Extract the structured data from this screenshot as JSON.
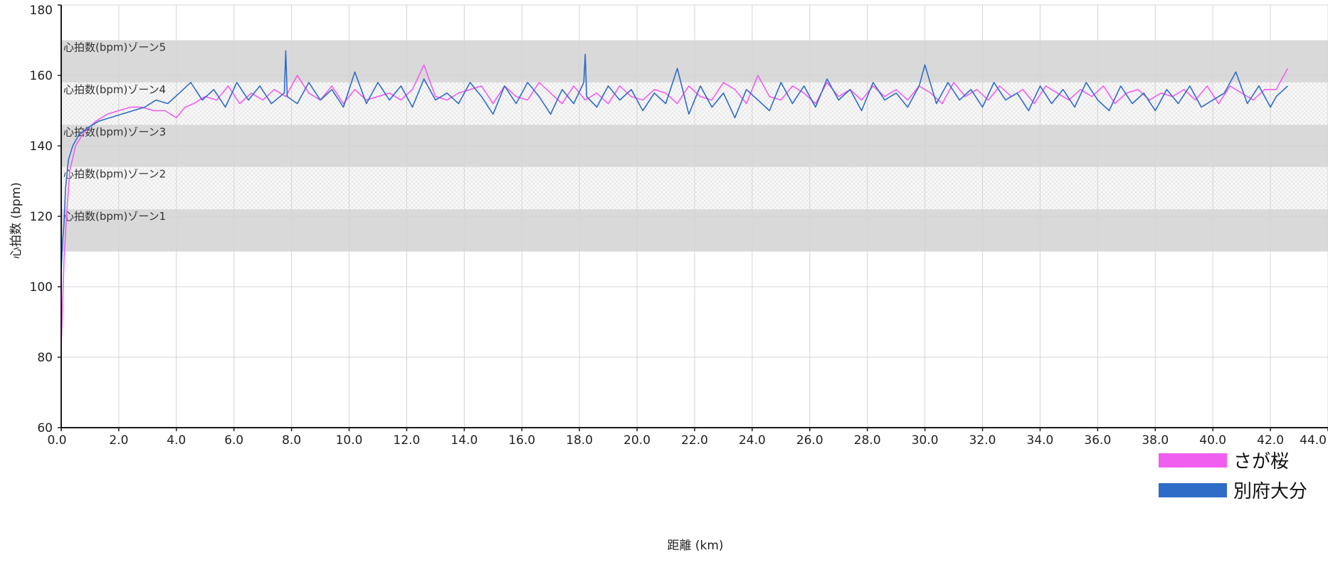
{
  "colors": {
    "series_sagazakura": "#f05ef0",
    "series_beppu_oita": "#2f6cc8",
    "zone_shade": "#d9d9d9",
    "zone_hatch": "#f1f1f1",
    "grid": "#d4d4d4",
    "axis": "#1a1a1a"
  },
  "chart_data": {
    "type": "line",
    "xlabel": "距離 (km)",
    "ylabel": "心拍数 (bpm)",
    "xlim": [
      0,
      44
    ],
    "ylim": [
      60,
      180
    ],
    "x_ticks": [
      "0.0",
      "2.0",
      "4.0",
      "6.0",
      "8.0",
      "10.0",
      "12.0",
      "14.0",
      "16.0",
      "18.0",
      "20.0",
      "22.0",
      "24.0",
      "26.0",
      "28.0",
      "30.0",
      "32.0",
      "34.0",
      "36.0",
      "38.0",
      "40.0",
      "42.0",
      "44.0"
    ],
    "y_ticks": [
      "60",
      "80",
      "100",
      "120",
      "140",
      "160",
      "180"
    ],
    "grid": true,
    "legend_position": "bottom-right",
    "zones": [
      {
        "label": "心拍数(bpm)ゾーン5",
        "from": 158,
        "to": 170,
        "style": "shaded"
      },
      {
        "label": "心拍数(bpm)ゾーン4",
        "from": 146,
        "to": 158,
        "style": "hatched"
      },
      {
        "label": "心拍数(bpm)ゾーン3",
        "from": 134,
        "to": 146,
        "style": "shaded"
      },
      {
        "label": "心拍数(bpm)ゾーン2",
        "from": 122,
        "to": 134,
        "style": "hatched"
      },
      {
        "label": "心拍数(bpm)ゾーン1",
        "from": 110,
        "to": 122,
        "style": "shaded"
      }
    ],
    "series": [
      {
        "name": "さが桜",
        "color": "#f05ef0",
        "x": [
          0.0,
          0.05,
          0.1,
          0.2,
          0.3,
          0.5,
          0.8,
          1.2,
          1.6,
          2.0,
          2.4,
          2.8,
          3.2,
          3.6,
          4.0,
          4.3,
          4.6,
          5.0,
          5.4,
          5.8,
          6.2,
          6.6,
          7.0,
          7.4,
          7.8,
          8.2,
          8.6,
          9.0,
          9.4,
          9.8,
          10.2,
          10.6,
          11.0,
          11.4,
          11.8,
          12.2,
          12.6,
          13.0,
          13.4,
          13.8,
          14.2,
          14.6,
          15.0,
          15.4,
          15.8,
          16.2,
          16.6,
          17.0,
          17.4,
          17.8,
          18.2,
          18.6,
          19.0,
          19.4,
          19.8,
          20.2,
          20.6,
          21.0,
          21.4,
          21.8,
          22.2,
          22.6,
          23.0,
          23.4,
          23.8,
          24.2,
          24.6,
          25.0,
          25.4,
          25.8,
          26.2,
          26.6,
          27.0,
          27.4,
          27.8,
          28.2,
          28.6,
          29.0,
          29.4,
          29.8,
          30.2,
          30.6,
          31.0,
          31.4,
          31.8,
          32.2,
          32.6,
          33.0,
          33.4,
          33.8,
          34.2,
          34.6,
          35.0,
          35.4,
          35.8,
          36.2,
          36.6,
          37.0,
          37.4,
          37.8,
          38.2,
          38.6,
          39.0,
          39.4,
          39.8,
          40.2,
          40.6,
          41.0,
          41.4,
          41.8,
          42.2,
          42.6
        ],
        "y": [
          83,
          95,
          108,
          122,
          133,
          140,
          144,
          147,
          149,
          150,
          151,
          151,
          150,
          150,
          148,
          151,
          152,
          154,
          153,
          157,
          152,
          155,
          153,
          156,
          154,
          160,
          155,
          153,
          157,
          152,
          156,
          153,
          154,
          155,
          153,
          156,
          163,
          154,
          153,
          155,
          156,
          157,
          152,
          157,
          154,
          153,
          158,
          155,
          152,
          157,
          153,
          155,
          152,
          157,
          154,
          153,
          156,
          155,
          152,
          157,
          154,
          153,
          158,
          156,
          152,
          160,
          154,
          153,
          157,
          155,
          152,
          158,
          154,
          156,
          153,
          157,
          154,
          156,
          153,
          157,
          155,
          152,
          158,
          154,
          156,
          153,
          157,
          154,
          156,
          152,
          157,
          155,
          153,
          156,
          154,
          157,
          152,
          155,
          156,
          153,
          155,
          154,
          156,
          153,
          157,
          152,
          157,
          155,
          153,
          156,
          156,
          162
        ]
      },
      {
        "name": "別府大分",
        "color": "#2f6cc8",
        "x": [
          0.0,
          0.05,
          0.1,
          0.15,
          0.25,
          0.4,
          0.6,
          0.9,
          1.3,
          1.7,
          2.1,
          2.5,
          2.9,
          3.3,
          3.7,
          4.1,
          4.5,
          4.9,
          5.3,
          5.7,
          6.1,
          6.5,
          6.9,
          7.3,
          7.75,
          7.8,
          7.85,
          8.2,
          8.6,
          9.0,
          9.4,
          9.8,
          10.2,
          10.6,
          11.0,
          11.4,
          11.8,
          12.2,
          12.6,
          13.0,
          13.4,
          13.8,
          14.2,
          14.6,
          15.0,
          15.4,
          15.8,
          16.2,
          16.6,
          17.0,
          17.4,
          17.8,
          18.15,
          18.2,
          18.25,
          18.6,
          19.0,
          19.4,
          19.8,
          20.2,
          20.6,
          21.0,
          21.4,
          21.8,
          22.2,
          22.6,
          23.0,
          23.4,
          23.8,
          24.2,
          24.6,
          25.0,
          25.4,
          25.8,
          26.2,
          26.6,
          27.0,
          27.4,
          27.8,
          28.2,
          28.6,
          29.0,
          29.4,
          29.8,
          30.0,
          30.4,
          30.8,
          31.2,
          31.6,
          32.0,
          32.4,
          32.8,
          33.2,
          33.6,
          34.0,
          34.4,
          34.8,
          35.2,
          35.6,
          36.0,
          36.4,
          36.8,
          37.2,
          37.6,
          38.0,
          38.4,
          38.8,
          39.2,
          39.6,
          40.0,
          40.4,
          40.8,
          41.2,
          41.6,
          42.0,
          42.2,
          42.6
        ],
        "y": [
          104,
          113,
          118,
          128,
          136,
          140,
          143,
          145,
          147,
          148,
          149,
          150,
          151,
          153,
          152,
          155,
          158,
          153,
          156,
          151,
          158,
          153,
          157,
          152,
          155,
          167,
          154,
          152,
          158,
          153,
          156,
          151,
          161,
          152,
          158,
          153,
          157,
          151,
          159,
          153,
          155,
          152,
          158,
          154,
          149,
          157,
          152,
          158,
          154,
          149,
          156,
          152,
          158,
          166,
          154,
          151,
          157,
          153,
          156,
          150,
          155,
          152,
          162,
          149,
          157,
          151,
          155,
          148,
          156,
          153,
          150,
          158,
          152,
          157,
          151,
          159,
          153,
          156,
          150,
          158,
          153,
          155,
          151,
          157,
          163,
          152,
          158,
          153,
          156,
          151,
          158,
          153,
          155,
          150,
          157,
          152,
          156,
          151,
          158,
          153,
          150,
          157,
          152,
          155,
          150,
          156,
          152,
          157,
          151,
          153,
          155,
          161,
          152,
          157,
          151,
          154,
          157
        ]
      }
    ]
  }
}
